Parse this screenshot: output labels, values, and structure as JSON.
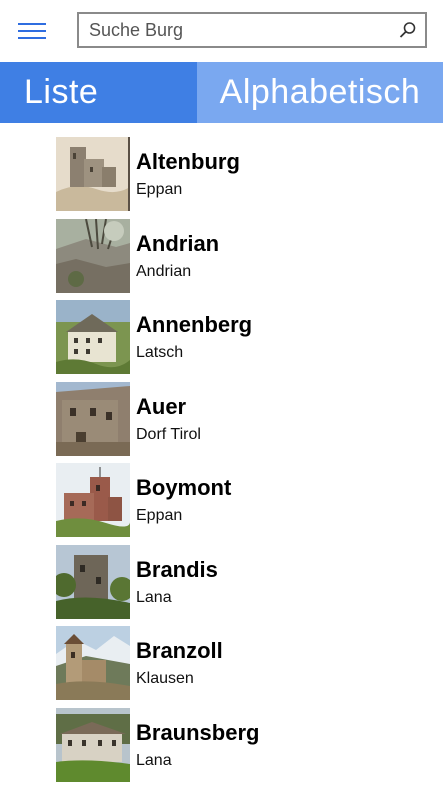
{
  "header": {
    "menu_icon": "hamburger-icon",
    "search": {
      "placeholder": "Suche Burg",
      "value": "",
      "icon": "search-icon"
    }
  },
  "tabs": [
    {
      "label": "Liste",
      "active": false
    },
    {
      "label": "Alphabetisch",
      "active": true
    }
  ],
  "colors": {
    "accent": "#3f7fe4",
    "tab_selected": "#7aa8f0",
    "hamburger": "#2f6de0"
  },
  "castles": [
    {
      "name": "Altenburg",
      "place": "Eppan"
    },
    {
      "name": "Andrian",
      "place": "Andrian"
    },
    {
      "name": "Annenberg",
      "place": "Latsch"
    },
    {
      "name": "Auer",
      "place": "Dorf Tirol"
    },
    {
      "name": "Boymont",
      "place": "Eppan"
    },
    {
      "name": "Brandis",
      "place": "Lana"
    },
    {
      "name": "Branzoll",
      "place": "Klausen"
    },
    {
      "name": "Braunsberg",
      "place": "Lana"
    }
  ]
}
